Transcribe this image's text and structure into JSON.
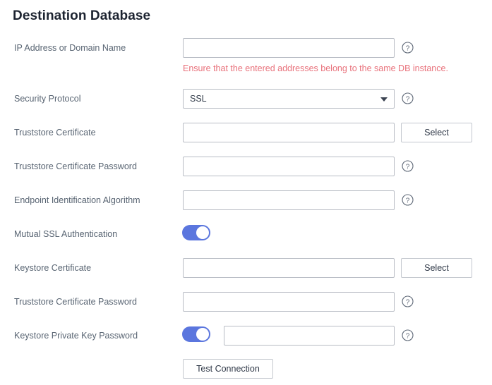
{
  "panel": {
    "title": "Destination Database"
  },
  "rows": {
    "ip_address": {
      "label": "IP Address or Domain Name",
      "value": "",
      "placeholder": "",
      "hint": "Ensure that the entered addresses belong to the same DB instance.",
      "help_icon": "help-circle-icon"
    },
    "security_protocol": {
      "label": "Security Protocol",
      "value": "SSL",
      "caret_icon": "chevron-down-icon",
      "help_icon": "help-circle-icon"
    },
    "truststore_certificate": {
      "label": "Truststore Certificate",
      "value": "",
      "placeholder": "",
      "select_button": "Select"
    },
    "truststore_certificate_password": {
      "label": "Truststore Certificate Password",
      "value": "",
      "placeholder": "",
      "help_icon": "help-circle-icon"
    },
    "endpoint_identification_algorithm": {
      "label": "Endpoint Identification Algorithm",
      "value": "",
      "placeholder": "",
      "help_icon": "help-circle-icon"
    },
    "mutual_ssl_authentication": {
      "label": "Mutual SSL Authentication",
      "toggle_state": "on"
    },
    "keystore_certificate": {
      "label": "Keystore Certificate",
      "value": "",
      "placeholder": "",
      "select_button": "Select"
    },
    "keystore_truststore_password": {
      "label": "Truststore Certificate Password",
      "value": "",
      "placeholder": "",
      "help_icon": "help-circle-icon"
    },
    "keystore_private_key_password": {
      "label": "Keystore Private Key Password",
      "toggle_state": "on",
      "value": "",
      "placeholder": "",
      "help_icon": "help-circle-icon"
    }
  },
  "actions": {
    "test_connection": "Test Connection"
  },
  "colors": {
    "toggle_on": "#5b76de",
    "hint": "#e8707a",
    "label": "#586472",
    "title": "#1c2330",
    "border": "#b8bcc4"
  }
}
